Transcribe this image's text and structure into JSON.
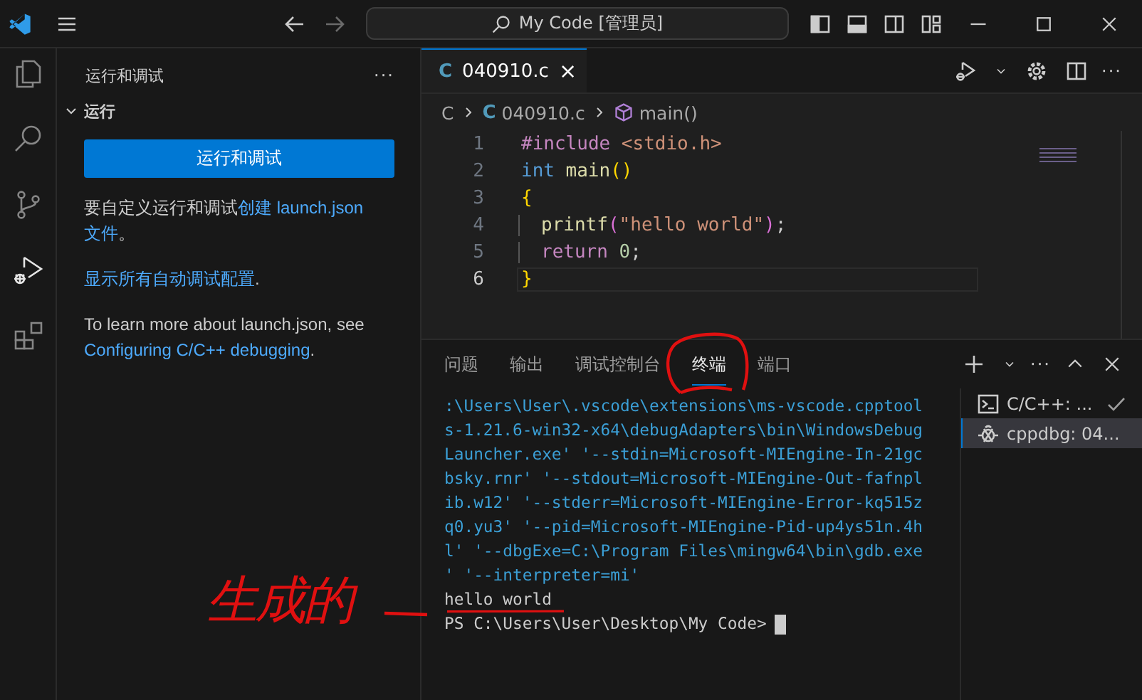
{
  "title_bar": {
    "search": "My Code [管理员]",
    "forward_disabled": true
  },
  "activity_bar": [
    {
      "kind": "files",
      "selected": false
    },
    {
      "kind": "search",
      "selected": false
    },
    {
      "kind": "source-control",
      "selected": false
    },
    {
      "kind": "run-debug",
      "selected": true
    },
    {
      "kind": "extensions",
      "selected": false
    }
  ],
  "sidebar": {
    "title": "运行和调试",
    "more": "···",
    "section": {
      "title": "运行",
      "expanded": true
    },
    "button": "运行和调试",
    "paragraphs": [
      [
        {
          "text": "要自定义运行和调试",
          "link": false
        },
        {
          "text": "创建 launch.json",
          "link": true
        },
        {
          "text": "文件",
          "link": true
        },
        {
          "text": "。",
          "link": false
        }
      ],
      [
        {
          "text": "显示所有自动调试配置",
          "link": true
        },
        {
          "text": ".",
          "link": false
        }
      ],
      [
        {
          "text": "To learn more about launch.json, see ",
          "link": false
        },
        {
          "text": "Configuring C/C++ debugging",
          "link": true
        },
        {
          "text": ".",
          "link": false
        }
      ]
    ]
  },
  "editor": {
    "tabs": [
      {
        "icon": "C",
        "label": "040910.c",
        "close": "×",
        "selected": true
      }
    ],
    "breadcrumb": {
      "folder": "C",
      "file_icon": "C",
      "file": "040910.c",
      "symbol": "main()"
    },
    "lines": [
      {
        "number": "1",
        "current": false,
        "guide": false,
        "tokens": [
          {
            "kind": "directive",
            "text": "#include"
          },
          {
            "kind": "header",
            "text": "<stdio.h>",
            "gap": true
          }
        ]
      },
      {
        "number": "2",
        "current": false,
        "guide": false,
        "tokens": [
          {
            "kind": "keyword",
            "text": "int"
          },
          {
            "kind": "function",
            "text": "main",
            "gap": true
          },
          {
            "kind": "bracket",
            "text": "()"
          }
        ]
      },
      {
        "number": "3",
        "current": false,
        "guide": false,
        "tokens": [
          {
            "kind": "bracket",
            "text": "{"
          }
        ]
      },
      {
        "number": "4",
        "current": false,
        "guide": true,
        "tokens": [
          {
            "kind": "function",
            "text": "printf"
          },
          {
            "kind": "bracket2",
            "text": "("
          },
          {
            "kind": "string",
            "text": "\"hello world\""
          },
          {
            "kind": "bracket2",
            "text": ")"
          },
          {
            "kind": "plain",
            "text": ";"
          }
        ]
      },
      {
        "number": "5",
        "current": false,
        "guide": true,
        "tokens": [
          {
            "kind": "control",
            "text": "return"
          },
          {
            "kind": "number",
            "text": "0",
            "gap": true
          },
          {
            "kind": "plain",
            "text": ";"
          }
        ]
      },
      {
        "number": "6",
        "current": true,
        "guide": false,
        "tokens": [
          {
            "kind": "bracket",
            "text": "}"
          }
        ]
      }
    ]
  },
  "panel": {
    "tabs": [
      {
        "label": "问题",
        "selected": false
      },
      {
        "label": "输出",
        "selected": false
      },
      {
        "label": "调试控制台",
        "selected": false
      },
      {
        "label": "终端",
        "selected": true
      },
      {
        "label": "端口",
        "selected": false
      }
    ],
    "terminal": [
      {
        "kind": "command",
        "text": ":\\Users\\User\\.vscode\\extensions\\ms-vscode.cpptool"
      },
      {
        "kind": "command",
        "text": "s-1.21.6-win32-x64\\debugAdapters\\bin\\WindowsDebug"
      },
      {
        "kind": "command",
        "text": "Launcher.exe' '--stdin=Microsoft-MIEngine-In-21gc"
      },
      {
        "kind": "command",
        "text": "bsky.rnr' '--stdout=Microsoft-MIEngine-Out-fafnpl"
      },
      {
        "kind": "command",
        "text": "ib.w12' '--stderr=Microsoft-MIEngine-Error-kq515z"
      },
      {
        "kind": "command",
        "text": "q0.yu3' '--pid=Microsoft-MIEngine-Pid-up4ys51n.4h"
      },
      {
        "kind": "command",
        "text": "l' '--dbgExe=C:\\Program Files\\mingw64\\bin\\gdb.exe"
      },
      {
        "kind": "command",
        "text": "' '--interpreter=mi'"
      },
      {
        "kind": "output",
        "text": "hello world"
      },
      {
        "kind": "prompt",
        "text": "PS C:\\Users\\User\\Desktop\\My Code>"
      }
    ],
    "sessions": [
      {
        "kind": "terminal",
        "label": "C/C++: ...",
        "done": true,
        "selected": false
      },
      {
        "kind": "debug",
        "label": "cppdbg: 04...",
        "done": false,
        "selected": true
      }
    ]
  },
  "annotation": {
    "text": "生成的"
  }
}
